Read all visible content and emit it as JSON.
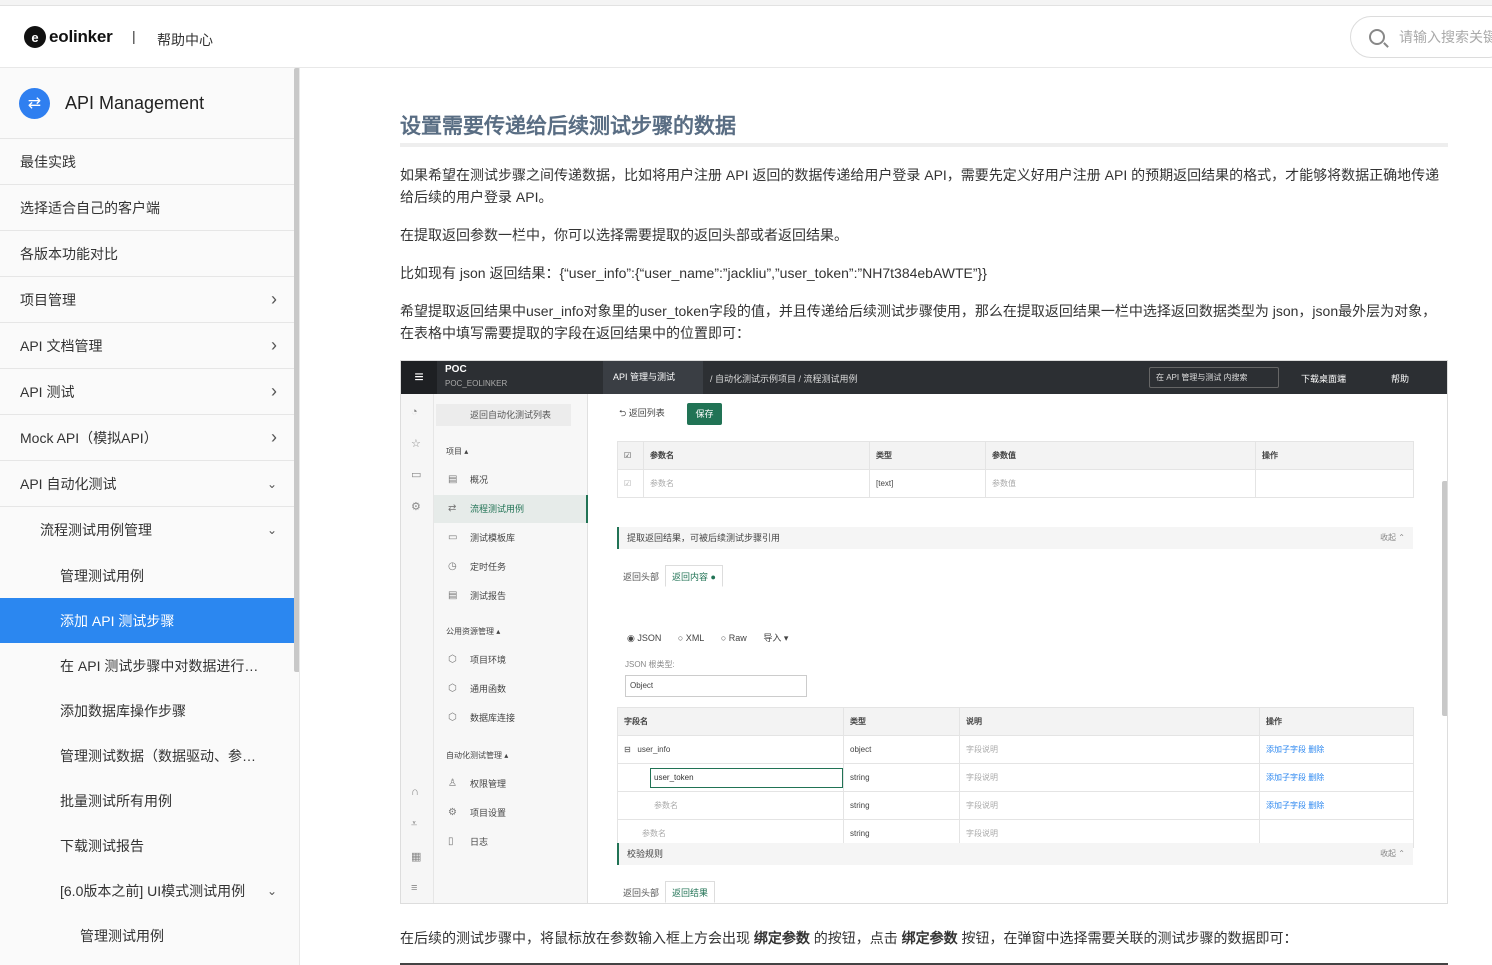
{
  "header": {
    "logo_text": "eolinker",
    "separator": "|",
    "help_center": "帮助中心",
    "search_placeholder": "请输入搜索关键"
  },
  "sidebar": {
    "title": "API Management",
    "items": [
      {
        "label": "最佳实践",
        "level": 0,
        "chevron": ""
      },
      {
        "label": "选择适合自己的客户端",
        "level": 0,
        "chevron": ""
      },
      {
        "label": "各版本功能对比",
        "level": 0,
        "chevron": ""
      },
      {
        "label": "项目管理",
        "level": 0,
        "chevron": "right"
      },
      {
        "label": "API 文档管理",
        "level": 0,
        "chevron": "right"
      },
      {
        "label": "API 测试",
        "level": 0,
        "chevron": "right"
      },
      {
        "label": "Mock API（模拟API）",
        "level": 0,
        "chevron": "right"
      },
      {
        "label": "API 自动化测试",
        "level": 0,
        "chevron": "down"
      },
      {
        "label": "流程测试用例管理",
        "level": 1,
        "chevron": "down"
      },
      {
        "label": "管理测试用例",
        "level": 2,
        "chevron": ""
      },
      {
        "label": "添加 API 测试步骤",
        "level": 2,
        "chevron": "",
        "active": true
      },
      {
        "label": "在 API 测试步骤中对数据进行…",
        "level": 2,
        "chevron": ""
      },
      {
        "label": "添加数据库操作步骤",
        "level": 2,
        "chevron": ""
      },
      {
        "label": "管理测试数据（数据驱动、参…",
        "level": 2,
        "chevron": ""
      },
      {
        "label": "批量测试所有用例",
        "level": 2,
        "chevron": ""
      },
      {
        "label": "下载测试报告",
        "level": 2,
        "chevron": ""
      },
      {
        "label": "[6.0版本之前] UI模式测试用例",
        "level": 2,
        "chevron": "down"
      },
      {
        "label": "管理测试用例",
        "level": 3,
        "chevron": ""
      }
    ]
  },
  "article": {
    "heading": "设置需要传递给后续测试步骤的数据",
    "para1": "如果希望在测试步骤之间传递数据，比如将用户注册 API 返回的数据传递给用户登录 API，需要先定义好用户注册 API 的预期返回结果的格式，才能够将数据正确地传递给后续的用户登录 API。",
    "para2": "在提取返回参数一栏中，你可以选择需要提取的返回头部或者返回结果。",
    "para3": "比如现有 json 返回结果：{“user_info”:{“user_name”:”jackliu”,”user_token”:”NH7t384ebAWTE”}}",
    "para4": "希望提取返回结果中user_info对象里的user_token字段的值，并且传递给后续测试步骤使用，那么在提取返回结果一栏中选择返回数据类型为 json，json最外层为对象，在表格中填写需要提取的字段在返回结果中的位置即可：",
    "para5_a": "在后续的测试步骤中，将鼠标放在参数输入框上方会出现 ",
    "para5_b": "绑定参数",
    "para5_c": " 的按钮，点击 ",
    "para5_d": "绑定参数",
    "para5_e": " 按钮，在弹窗中选择需要关联的测试步骤的数据即可："
  },
  "screenshot": {
    "workspace": "POC",
    "workspace_sub": "POC_EOLINKER",
    "tab": "API 管理与测试",
    "breadcrumb": "/ 自动化测试示例项目 / 流程测试用例",
    "search": "在 API 管理与测试 内搜索",
    "download": "下载桌面端",
    "help": "帮助",
    "back_list": "返回自动化测试列表",
    "group_project": "项目 ▴",
    "menu_overview": "概况",
    "menu_flow": "流程测试用例",
    "menu_template": "测试模板库",
    "menu_timer": "定时任务",
    "menu_report": "测试报告",
    "group_public": "公用资源管理 ▴",
    "menu_env": "项目环境",
    "menu_func": "通用函数",
    "menu_db": "数据库连接",
    "group_auto": "自动化测试管理 ▴",
    "menu_perm": "权限管理",
    "menu_setting": "项目设置",
    "menu_log": "日志",
    "btn_back": "返回列表",
    "btn_save": "保存",
    "param_headers": [
      "参数名",
      "类型",
      "参数值",
      "操作"
    ],
    "param_row": [
      "参数名",
      "[text]",
      "参数值"
    ],
    "section_extract": "提取返回结果，可被后续测试步骤引用",
    "fold": "收起 ⌃",
    "tab_headers": "返回头部",
    "tab_content": "返回内容 ●",
    "radio_json": "◉ JSON",
    "radio_xml": "○ XML",
    "radio_raw": "○ Raw",
    "import": "导入 ▾",
    "json_root_label": "JSON 根类型:",
    "json_root_value": "Object",
    "field_headers": [
      "字段名",
      "类型",
      "说明",
      "操作"
    ],
    "field_rows": [
      {
        "name": "user_info",
        "type": "object",
        "desc": "字段说明",
        "ops": "添加子字段   删除"
      },
      {
        "name": "user_token",
        "type": "string",
        "desc": "字段说明",
        "ops": "添加子字段   删除"
      },
      {
        "name": "参数名",
        "type": "string",
        "desc": "字段说明",
        "ops": "添加子字段   删除"
      },
      {
        "name": "参数名",
        "type": "string",
        "desc": "字段说明",
        "ops": ""
      }
    ],
    "section_verify": "校验规则",
    "tab_result": "返回结果"
  }
}
